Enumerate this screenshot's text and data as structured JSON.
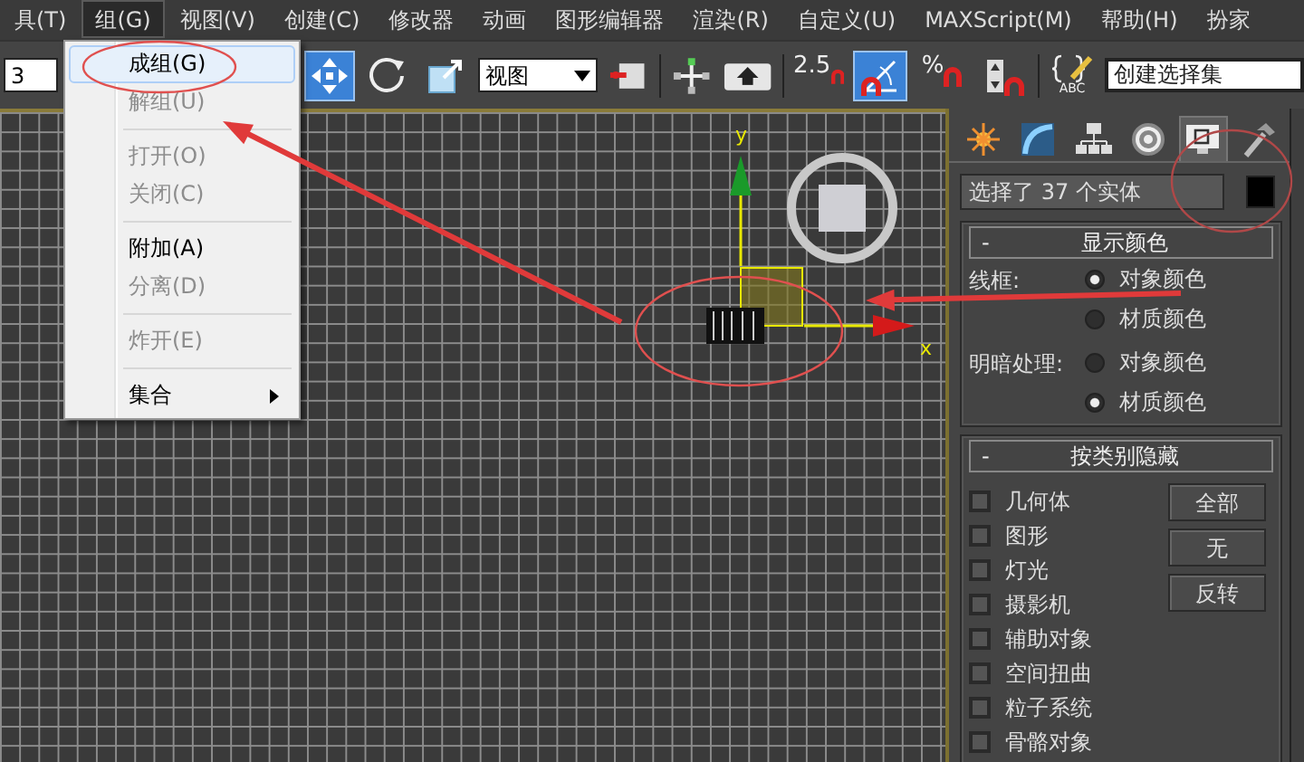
{
  "menubar": [
    {
      "label": "具(T)",
      "selected": false
    },
    {
      "label": "组(G)",
      "selected": true
    },
    {
      "label": "视图(V)",
      "selected": false
    },
    {
      "label": "创建(C)",
      "selected": false
    },
    {
      "label": "修改器",
      "selected": false
    },
    {
      "label": "动画",
      "selected": false
    },
    {
      "label": "图形编辑器",
      "selected": false
    },
    {
      "label": "渲染(R)",
      "selected": false
    },
    {
      "label": "自定义(U)",
      "selected": false
    },
    {
      "label": "MAXScript(M)",
      "selected": false
    },
    {
      "label": "帮助(H)",
      "selected": false
    },
    {
      "label": "扮家",
      "selected": false
    }
  ],
  "toolbar": {
    "filter_dropdown": "3",
    "transform_tools": [
      {
        "selected": true
      },
      {
        "selected": false
      },
      {
        "selected": false
      }
    ],
    "reference_coordinate": "视图",
    "snap_tools": [
      {
        "label": "2.5",
        "selected": false
      },
      {
        "selected": true
      },
      {
        "label": "%",
        "selected": false
      },
      {
        "selected": false
      }
    ],
    "abc_label": "ABC",
    "named_selection_field": "创建选择集"
  },
  "group_menu": {
    "items": [
      {
        "kind": "item",
        "label": "成组(G)",
        "disabled": false,
        "selected": true,
        "submenu": false
      },
      {
        "kind": "item",
        "label": "解组(U)",
        "disabled": true,
        "selected": false,
        "submenu": false
      },
      {
        "kind": "separator"
      },
      {
        "kind": "item",
        "label": "打开(O)",
        "disabled": true,
        "selected": false,
        "submenu": false
      },
      {
        "kind": "item",
        "label": "关闭(C)",
        "disabled": true,
        "selected": false,
        "submenu": false
      },
      {
        "kind": "separator"
      },
      {
        "kind": "item",
        "label": "附加(A)",
        "disabled": false,
        "selected": false,
        "submenu": false
      },
      {
        "kind": "item",
        "label": "分离(D)",
        "disabled": true,
        "selected": false,
        "submenu": false
      },
      {
        "kind": "separator"
      },
      {
        "kind": "item",
        "label": "炸开(E)",
        "disabled": true,
        "selected": false,
        "submenu": false
      },
      {
        "kind": "separator"
      },
      {
        "kind": "item",
        "label": "集合",
        "disabled": false,
        "selected": false,
        "submenu": true
      }
    ]
  },
  "viewport": {
    "y_axis_label": "y",
    "x_axis_label": "x"
  },
  "command_panel": {
    "tabs": [
      {
        "selected": false
      },
      {
        "selected": false
      },
      {
        "selected": false
      },
      {
        "selected": false
      },
      {
        "selected": true
      },
      {
        "selected": false
      }
    ],
    "object_name": "选择了 37 个实体",
    "rollouts": [
      {
        "kind": "radio_groups",
        "collapse_sign": "-",
        "title": "显示颜色",
        "groups": [
          {
            "label": "线框:",
            "options": [
              {
                "label": "对象颜色",
                "selected": true
              },
              {
                "label": "材质颜色",
                "selected": false
              }
            ]
          },
          {
            "label": "明暗处理:",
            "options": [
              {
                "label": "对象颜色",
                "selected": false
              },
              {
                "label": "材质颜色",
                "selected": true
              }
            ]
          }
        ]
      },
      {
        "kind": "checkboxes",
        "collapse_sign": "-",
        "title": "按类别隐藏",
        "checkboxes": [
          {
            "label": "几何体",
            "checked": false
          },
          {
            "label": "图形",
            "checked": false
          },
          {
            "label": "灯光",
            "checked": false
          },
          {
            "label": "摄影机",
            "checked": false
          },
          {
            "label": "辅助对象",
            "checked": false
          },
          {
            "label": "空间扭曲",
            "checked": false
          },
          {
            "label": "粒子系统",
            "checked": false
          },
          {
            "label": "骨骼对象",
            "checked": false
          }
        ],
        "buttons": [
          "全部",
          "无",
          "反转"
        ]
      }
    ]
  }
}
